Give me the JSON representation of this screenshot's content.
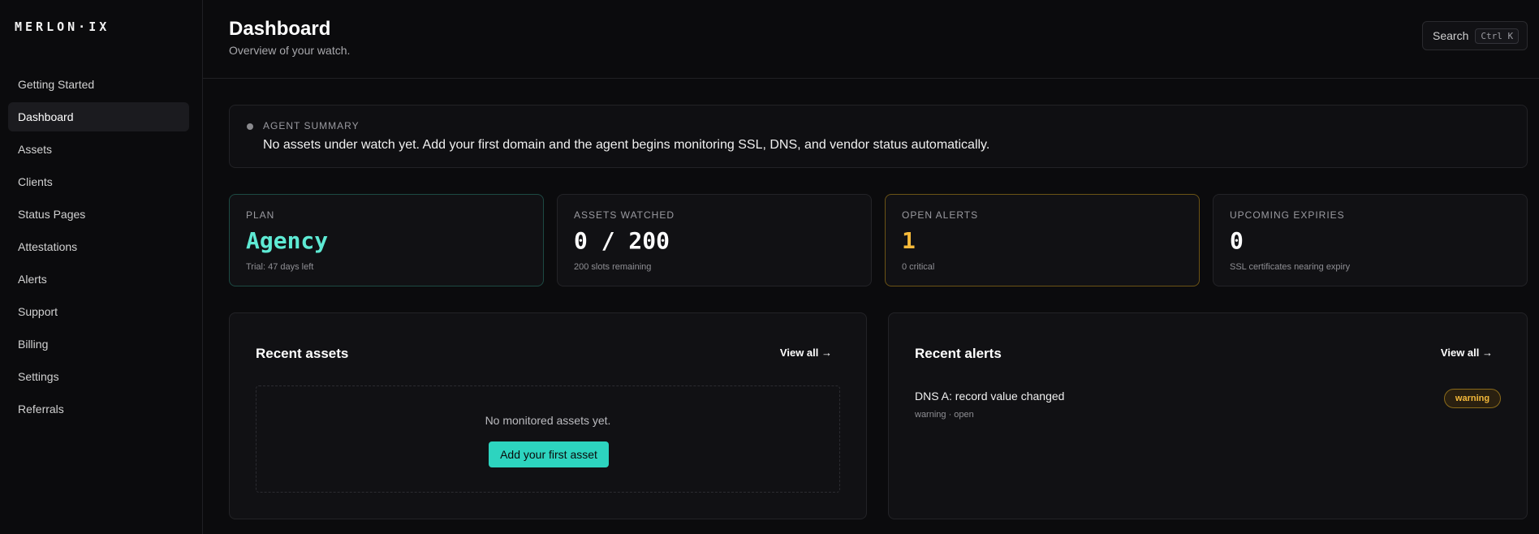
{
  "app": {
    "logo": "MERLON·IX"
  },
  "sidebar": {
    "items": [
      {
        "label": "Getting Started",
        "active": false
      },
      {
        "label": "Dashboard",
        "active": true
      },
      {
        "label": "Assets",
        "active": false
      },
      {
        "label": "Clients",
        "active": false
      },
      {
        "label": "Status Pages",
        "active": false
      },
      {
        "label": "Attestations",
        "active": false
      },
      {
        "label": "Alerts",
        "active": false
      },
      {
        "label": "Support",
        "active": false
      },
      {
        "label": "Billing",
        "active": false
      },
      {
        "label": "Settings",
        "active": false
      },
      {
        "label": "Referrals",
        "active": false
      }
    ]
  },
  "header": {
    "title": "Dashboard",
    "subtitle": "Overview of your watch.",
    "search_label": "Search",
    "search_shortcut": "Ctrl K"
  },
  "summary": {
    "label": "AGENT SUMMARY",
    "text": "No assets under watch yet. Add your first domain and the agent begins monitoring SSL, DNS, and vendor status automatically."
  },
  "stats": {
    "plan": {
      "label": "PLAN",
      "value": "Agency",
      "sub": "Trial: 47 days left",
      "color": "#5eead4"
    },
    "assets": {
      "label": "ASSETS WATCHED",
      "value": "0 / 200",
      "sub": "200 slots remaining"
    },
    "alerts": {
      "label": "OPEN ALERTS",
      "value": "1",
      "sub": "0 critical",
      "color": "#f5b93a"
    },
    "expiries": {
      "label": "UPCOMING EXPIRIES",
      "value": "0",
      "sub": "SSL certificates nearing expiry"
    }
  },
  "recent_assets": {
    "title": "Recent assets",
    "view_all": "View all →",
    "empty_text": "No monitored assets yet.",
    "add_button": "Add your first asset"
  },
  "recent_alerts": {
    "title": "Recent alerts",
    "view_all": "View all →",
    "items": [
      {
        "title": "DNS A: record value changed",
        "meta": "warning · open",
        "badge": "warning"
      }
    ]
  },
  "colors": {
    "accent": "#2dd4bf",
    "warning": "#f5b93a"
  }
}
